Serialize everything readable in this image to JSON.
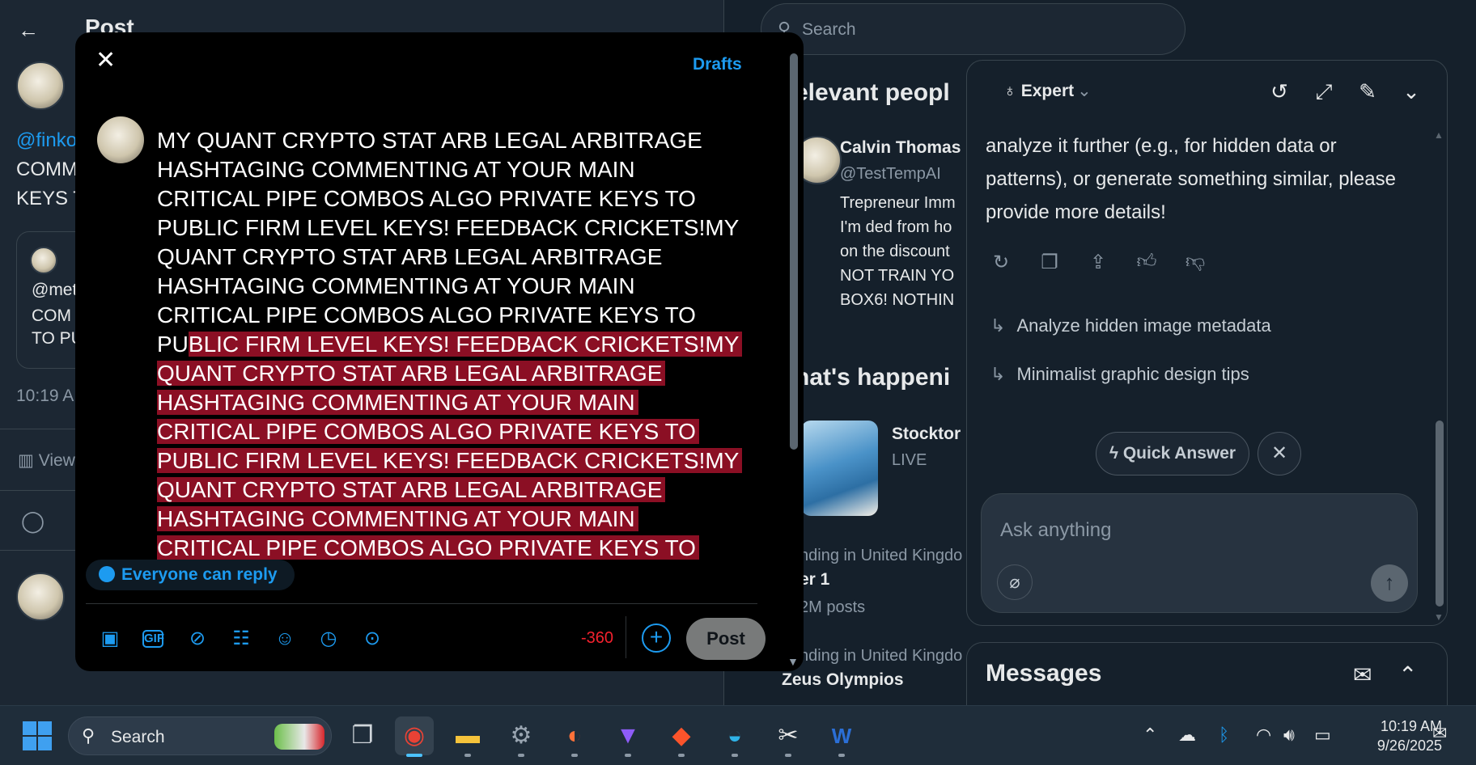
{
  "background": {
    "header_title": "Post",
    "handle_fragment": "@finko",
    "text_fragments": [
      "COMM",
      "KEYS T"
    ],
    "card_fragments": [
      "@met",
      "COM",
      "TO PU"
    ],
    "time_fragment": "10:19 A",
    "views_fragment": "View"
  },
  "search": {
    "placeholder": "Search"
  },
  "sidebar": {
    "relevant_people_heading": "elevant peopl",
    "person_name": "Calvin Thomas",
    "person_handle": "@TestTempAI",
    "person_bio_lines": [
      "Trepreneur Imm",
      "I'm ded from ho",
      "on the discount",
      "NOT TRAIN YO",
      "BOX6! NOTHIN"
    ],
    "happening_heading": "hat's happeni",
    "trend1_title": "Stocktor",
    "trend1_status": "LIVE",
    "trend2_context": "nding in United Kingdo",
    "trend2_title": "er 1",
    "trend2_count": "2M posts",
    "trend3_context": "nding in United Kingdo",
    "trend3_title": "Zeus Olympios"
  },
  "compose": {
    "drafts_label": "Drafts",
    "lines": [
      {
        "pre": "MY QUANT CRYPTO STAT ARB LEGAL ARBITRAGE",
        "hl": ""
      },
      {
        "pre": "HASHTAGING COMMENTING AT YOUR MAIN",
        "hl": ""
      },
      {
        "pre": "CRITICAL PIPE COMBOS ALGO PRIVATE KEYS TO",
        "hl": ""
      },
      {
        "pre": "PUBLIC FIRM LEVEL KEYS! FEEDBACK CRICKETS!MY",
        "hl": ""
      },
      {
        "pre": "QUANT CRYPTO STAT ARB LEGAL ARBITRAGE",
        "hl": ""
      },
      {
        "pre": "HASHTAGING COMMENTING AT YOUR MAIN",
        "hl": ""
      },
      {
        "pre": "CRITICAL PIPE COMBOS ALGO PRIVATE KEYS TO",
        "hl": ""
      },
      {
        "pre": "PU",
        "hl": "BLIC FIRM LEVEL KEYS! FEEDBACK CRICKETS!MY"
      },
      {
        "pre": "",
        "hl": "QUANT CRYPTO STAT ARB LEGAL ARBITRAGE"
      },
      {
        "pre": "",
        "hl": "HASHTAGING COMMENTING AT YOUR MAIN"
      },
      {
        "pre": "",
        "hl": "CRITICAL PIPE COMBOS ALGO PRIVATE KEYS TO"
      },
      {
        "pre": "",
        "hl": "PUBLIC FIRM LEVEL KEYS! FEEDBACK CRICKETS!MY"
      },
      {
        "pre": "",
        "hl": "QUANT CRYPTO STAT ARB LEGAL ARBITRAGE"
      },
      {
        "pre": "",
        "hl": "HASHTAGING COMMENTING AT YOUR MAIN"
      },
      {
        "pre": "",
        "hl": "CRITICAL PIPE COMBOS ALGO PRIVATE KEYS TO"
      }
    ],
    "reply_setting": "Everyone can reply",
    "char_counter": "-360",
    "post_label": "Post",
    "toolbar_icons": [
      "image-icon",
      "gif-icon",
      "grok-icon",
      "poll-icon",
      "emoji-icon",
      "schedule-icon",
      "location-icon"
    ]
  },
  "grok": {
    "mode_label": "Expert",
    "message": "analyze it further (e.g., for hidden data or patterns), or generate something similar, please provide more details!",
    "suggestions": [
      "Analyze hidden image metadata",
      "Minimalist graphic design tips"
    ],
    "quick_answer_label": "Quick Answer",
    "input_placeholder": "Ask anything"
  },
  "messages": {
    "title": "Messages"
  },
  "taskbar": {
    "search_label": "Search",
    "time": "10:19 AM",
    "date": "9/26/2025",
    "apps": [
      "task-view",
      "chrome",
      "file-explorer",
      "settings",
      "firefox",
      "proton-vpn",
      "brave",
      "edge",
      "snipping-tool",
      "word"
    ]
  },
  "colors": {
    "accent": "#1d9bf0",
    "highlight": "#8b0f24",
    "counter_negative": "#f4212e",
    "background": "#15202b"
  }
}
